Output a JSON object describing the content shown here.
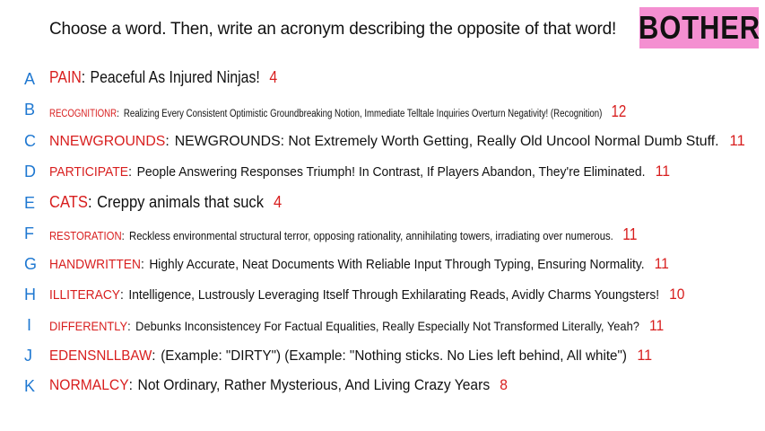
{
  "header": {
    "prompt": "Choose a word. Then, write an acronym describing the opposite of that word!",
    "word": "BOTHER",
    "badge_color": "#f48fd1"
  },
  "colors": {
    "letter": "#1f78d1",
    "word": "#d81e1e",
    "text": "#111111",
    "count": "#d81e1e"
  },
  "entries": [
    {
      "letter": "A",
      "word": "PAIN",
      "acronym": "Peaceful As Injured Ninjas!",
      "count": "4"
    },
    {
      "letter": "B",
      "word": "RECOGNITIONR",
      "acronym": "Realizing Every Consistent Optimistic Groundbreaking Notion, Immediate Telltale Inquiries Overturn Negativity! (Recognition)",
      "count": "12"
    },
    {
      "letter": "C",
      "word": "NNEWGROUNDS",
      "acronym": "NEWGROUNDS: Not Extremely Worth Getting, Really Old Uncool Normal Dumb Stuff.",
      "count": "11"
    },
    {
      "letter": "D",
      "word": "PARTICIPATE",
      "acronym": "People Answering Responses Triumph! In Contrast, If Players Abandon, They're Eliminated.",
      "count": "11"
    },
    {
      "letter": "E",
      "word": "CATS",
      "acronym": "Creppy animals that suck",
      "count": "4"
    },
    {
      "letter": "F",
      "word": "RESTORATION",
      "acronym": "Reckless environmental structural terror, opposing rationality, annihilating towers, irradiating over numerous.",
      "count": "11"
    },
    {
      "letter": "G",
      "word": "HANDWRITTEN",
      "acronym": "Highly Accurate, Neat Documents With Reliable Input Through Typing, Ensuring Normality.",
      "count": "11"
    },
    {
      "letter": "H",
      "word": "ILLITERACY",
      "acronym": "Intelligence, Lustrously Leveraging Itself Through Exhilarating Reads, Avidly Charms Youngsters!",
      "count": "10"
    },
    {
      "letter": "I",
      "word": "DIFFERENTLY",
      "acronym": "Debunks Inconsistencey For Factual Equalities, Really Especially Not Transformed Literally, Yeah?",
      "count": "11"
    },
    {
      "letter": "J",
      "word": "EDENSNLLBAW",
      "acronym": "(Example: \"DIRTY\") (Example: \"Nothing sticks. No Lies left behind, All white\")",
      "count": "11"
    },
    {
      "letter": "K",
      "word": "NORMALCY",
      "acronym": "Not Ordinary, Rather Mysterious, And Living Crazy Years",
      "count": "8"
    }
  ]
}
